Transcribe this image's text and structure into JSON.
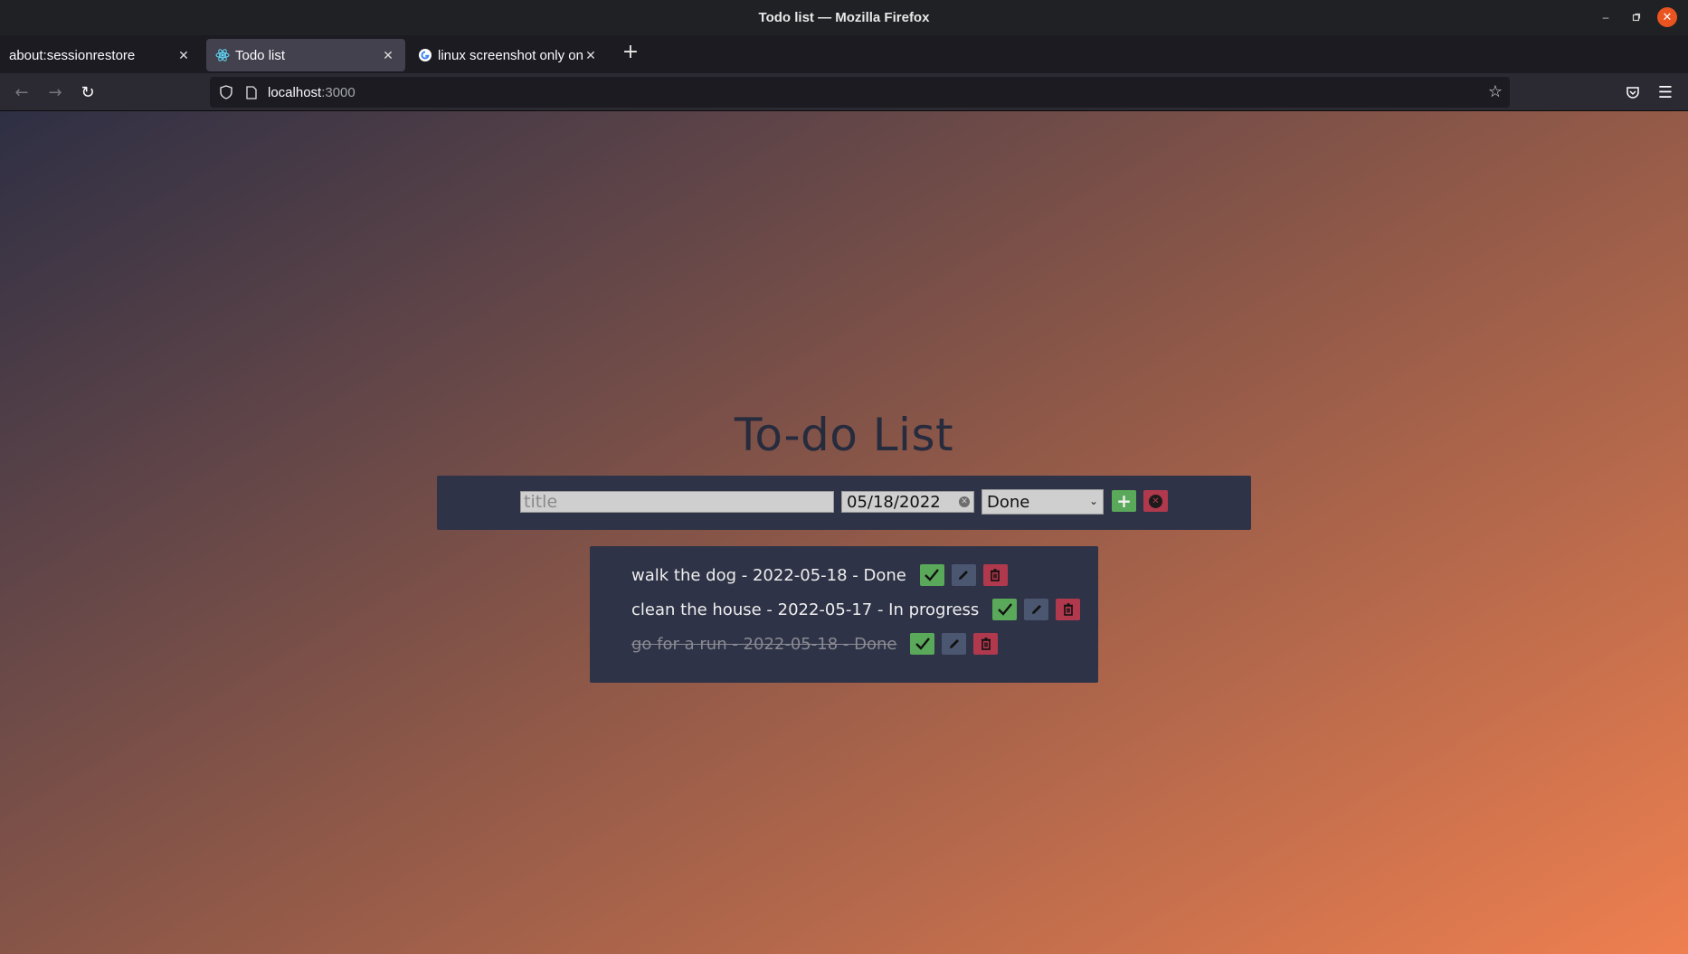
{
  "window": {
    "title": "Todo list — Mozilla Firefox"
  },
  "tabs": [
    {
      "label": "about:sessionrestore",
      "active": false
    },
    {
      "label": "Todo list",
      "active": true
    },
    {
      "label": "linux screenshot only one",
      "active": false
    }
  ],
  "nav": {
    "url_host": "localhost",
    "url_port": ":3000"
  },
  "app": {
    "heading": "To-do List",
    "form": {
      "title_placeholder": "title",
      "date_value": "05/18/2022",
      "status_value": "Done",
      "add_label": "+"
    },
    "todos": [
      {
        "text": "walk the dog - 2022-05-18 - Done",
        "completed": false
      },
      {
        "text": "clean the house - 2022-05-17 - In progress",
        "completed": false
      },
      {
        "text": "go for a run - 2022-05-18 - Done",
        "completed": true
      }
    ]
  },
  "colors": {
    "accent_orange": "#e95420",
    "check_green": "#5aa85a",
    "edit_slate": "#4b5671",
    "delete_red": "#b0394d",
    "panel_bg": "#2e3347"
  },
  "icons": [
    "minimize-icon",
    "restore-icon",
    "close-icon",
    "back-icon",
    "forward-icon",
    "reload-icon",
    "shield-icon",
    "page-icon",
    "star-icon",
    "pocket-icon",
    "menu-icon",
    "check-icon",
    "pencil-icon",
    "trash-icon"
  ]
}
